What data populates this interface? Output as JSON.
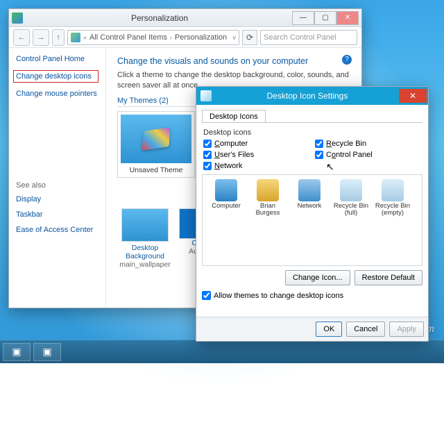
{
  "personalization": {
    "title": "Personalization",
    "breadcrumb": {
      "root": "All Control Panel Items",
      "current": "Personalization"
    },
    "search_placeholder": "Search Control Panel",
    "heading": "Change the visuals and sounds on your computer",
    "subtext": "Click a theme to change the desktop background, color, sounds, and screen saver all at once.",
    "sidebar": {
      "home": "Control Panel Home",
      "change_icons": "Change desktop icons",
      "change_pointers": "Change mouse pointers",
      "see_also_label": "See also",
      "see_also": [
        "Display",
        "Taskbar",
        "Ease of Access Center"
      ]
    },
    "themes_label": "My Themes (2)",
    "theme_name": "Unsaved Theme",
    "bg_tile": {
      "label": "Desktop Background",
      "value": "main_wallpaper"
    },
    "color_tile": {
      "label": "C",
      "value": "Aut"
    }
  },
  "dialog": {
    "title": "Desktop Icon Settings",
    "tab": "Desktop Icons",
    "group_label": "Desktop icons",
    "checks": {
      "computer": {
        "label": "Computer",
        "checked": true
      },
      "recycle": {
        "label": "Recycle Bin",
        "checked": true
      },
      "users": {
        "label": "User's Files",
        "checked": true
      },
      "cpanel": {
        "label": "Control Panel",
        "checked": true
      },
      "network": {
        "label": "Network",
        "checked": true
      }
    },
    "icons": [
      {
        "id": "computer",
        "label": "Computer"
      },
      {
        "id": "user",
        "label": "Brian Burgess"
      },
      {
        "id": "network",
        "label": "Network"
      },
      {
        "id": "rbfull",
        "label": "Recycle Bin (full)"
      },
      {
        "id": "rbempty",
        "label": "Recycle Bin (empty)"
      }
    ],
    "change_icon_btn": "Change Icon...",
    "restore_btn": "Restore Default",
    "allow_themes": {
      "label": "Allow themes to change desktop icons",
      "checked": true
    },
    "ok": "OK",
    "cancel": "Cancel",
    "apply": "Apply"
  },
  "watermark": "groovyPost.com"
}
